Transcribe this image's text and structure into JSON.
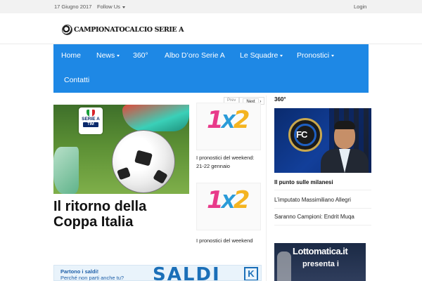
{
  "topbar": {
    "date": "17 Giugno 2017",
    "follow_label": "Follow Us",
    "login_label": "Login"
  },
  "site": {
    "logo_text": "CAMPIONATOCALCIO SERIE A"
  },
  "nav": {
    "items": [
      {
        "label": "Home"
      },
      {
        "label": "News"
      },
      {
        "label": "360°"
      },
      {
        "label": "Albo D’oro Serie A"
      },
      {
        "label": "Le Squadre"
      },
      {
        "label": "Pronostici"
      },
      {
        "label": "Contatti"
      }
    ],
    "color": "#1e88e5"
  },
  "featured": {
    "badge_line1": "SERIE A",
    "badge_line2": "TIM",
    "headline": "Il ritorno della Coppa Italia"
  },
  "pager": {
    "prev": "Prev",
    "next": "Next"
  },
  "middle": {
    "logo_text": {
      "one": "1",
      "x": "X",
      "two": "2"
    },
    "articles": [
      {
        "title": "I pronostici del weekend: 21-22 gennaio"
      },
      {
        "title": "I pronostici del weekend"
      }
    ]
  },
  "sidebar": {
    "heading": "360°",
    "inter_badge": "FC",
    "lead_title": "Il punto sulle milanesi",
    "articles": [
      {
        "title": "L’imputato Massimiliano Allegri"
      },
      {
        "title": "Saranno Campioni: Endrit Muqa"
      }
    ],
    "ad": {
      "brand": "Lottomatica.it",
      "sub": "presenta i"
    }
  },
  "banner": {
    "line1": "Partono i saldi!",
    "line2": "Perché non parti anche tu?",
    "big_text": "SALDI",
    "icon_glyph": "K"
  }
}
